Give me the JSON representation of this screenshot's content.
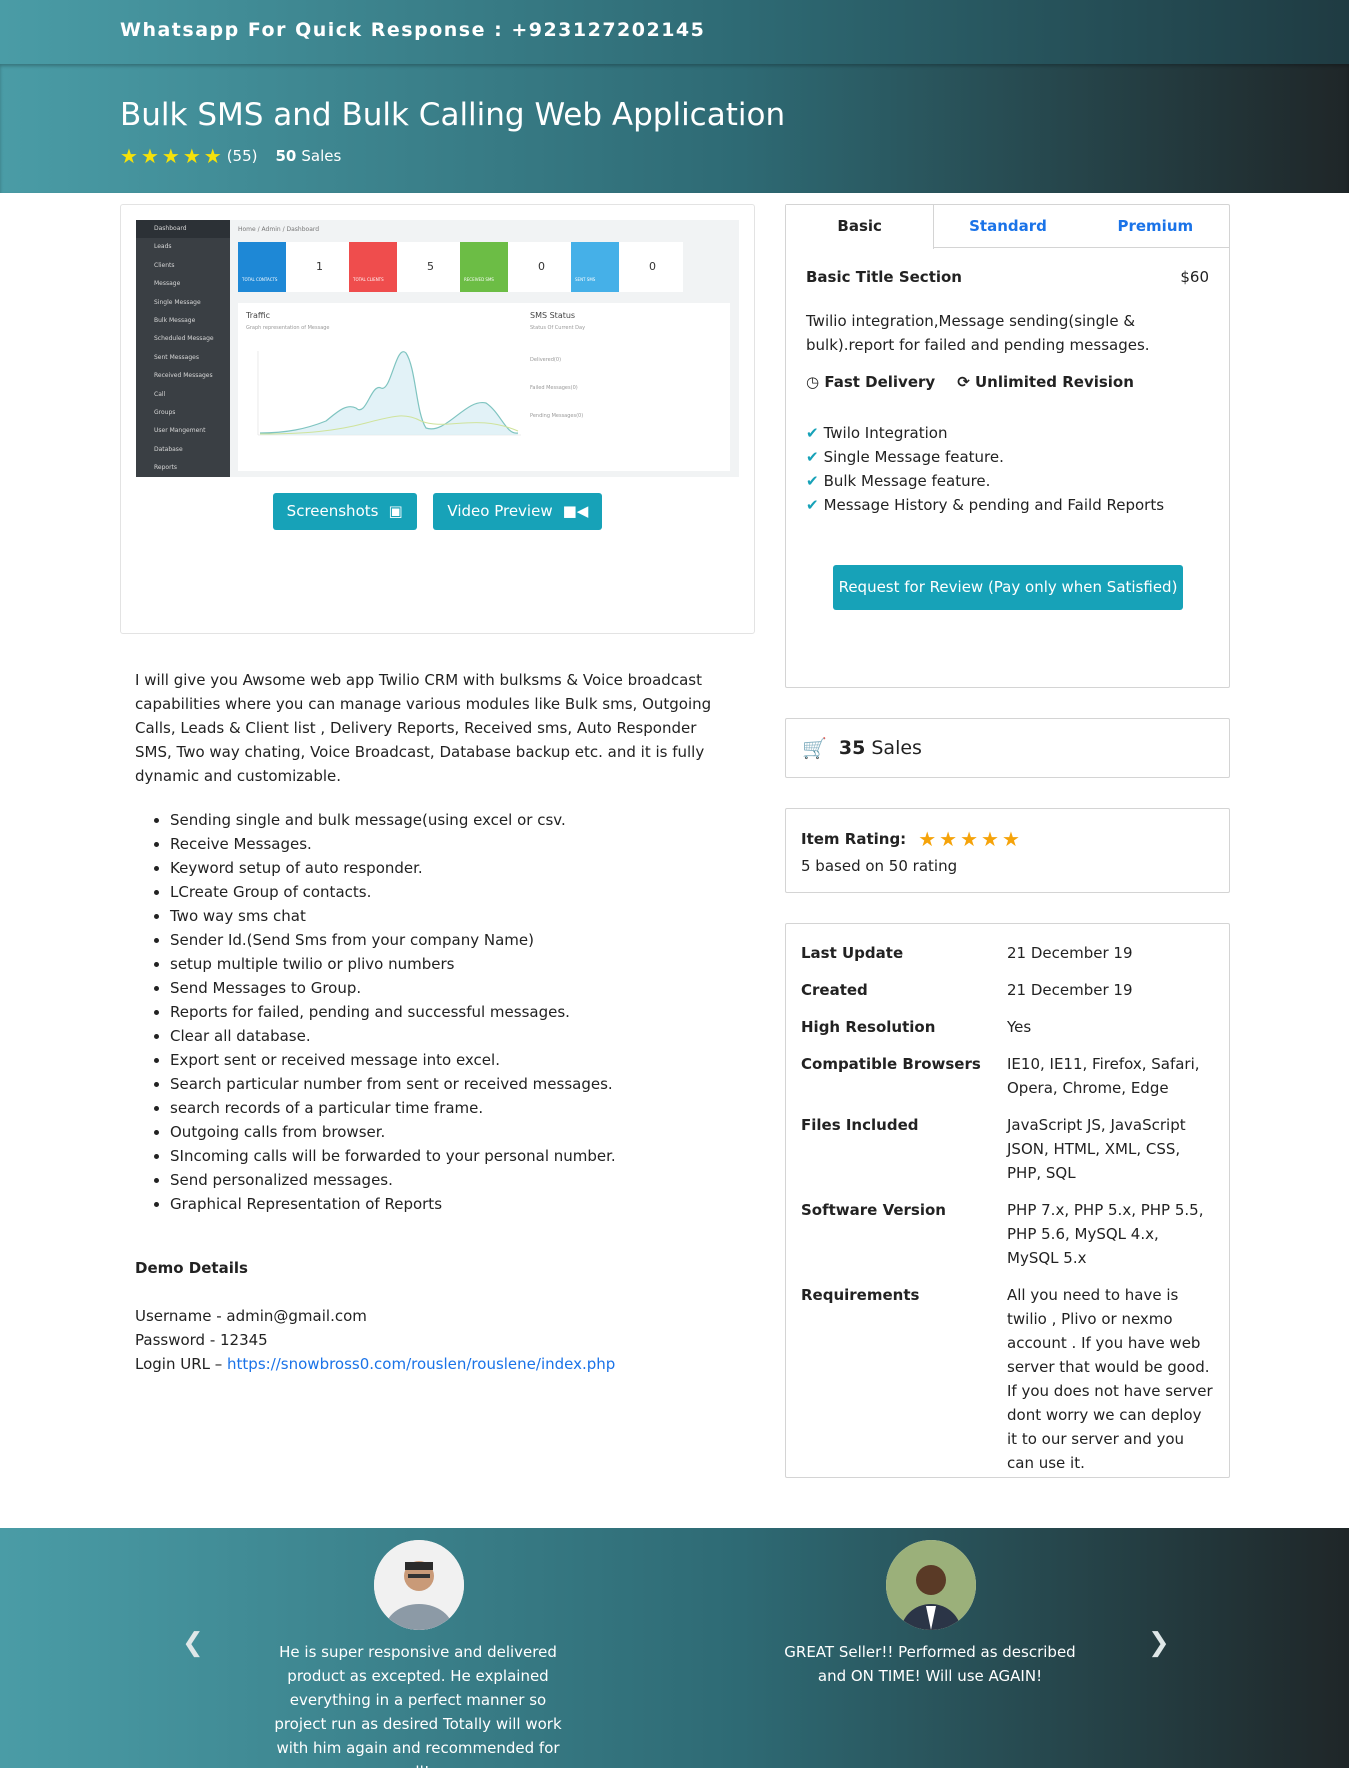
{
  "topbar": {
    "whatsapp": "Whatsapp For Quick Response : +923127202145"
  },
  "hero": {
    "title": "Bulk SMS and Bulk Calling Web Application",
    "rating_count": "(55)",
    "sales_num": "50",
    "sales_label": "Sales"
  },
  "screenshot": {
    "sidebar": [
      "Dashboard",
      "Leads",
      "Clients",
      "Message",
      "Single Message",
      "Bulk Message",
      "Scheduled Message",
      "Sent Messages",
      "Received Messages",
      "Call",
      "Groups",
      "User Mangement",
      "Database",
      "Reports"
    ],
    "crumb": "Home / Admin / Dashboard",
    "kpis": [
      {
        "label": "TOTAL CONTACTS",
        "value": "1",
        "color": "#1e88d6"
      },
      {
        "label": "TOTAL CLIENTS",
        "value": "5",
        "color": "#ef4d4d"
      },
      {
        "label": "RECEIVED SMS",
        "value": "0",
        "color": "#6cbd45"
      },
      {
        "label": "SENT SMS",
        "value": "0",
        "color": "#45b0e8"
      }
    ],
    "panel_title": "Traffic",
    "panel_sub": "Graph representation of Message",
    "status_title": "SMS Status",
    "status_sub": "Status Of Current Day",
    "status_items": [
      "Delivered(0)",
      "Failed Messages(0)",
      "Pending Messages(0)"
    ]
  },
  "buttons": {
    "screenshots": "Screenshots",
    "video": "Video Preview"
  },
  "description": {
    "intro": "I will give you Awsome web app Twilio CRM with bulksms & Voice broadcast capabilities where you can manage various modules like Bulk sms, Outgoing Calls, Leads & Client list , Delivery Reports, Received sms, Auto Responder SMS, Two way chating, Voice Broadcast, Database backup etc. and it is fully dynamic and customizable.",
    "features": [
      "Sending single and bulk message(using excel or csv.",
      "Receive Messages.",
      "Keyword setup of auto responder.",
      "LCreate Group of contacts.",
      "Two way sms chat",
      "Sender Id.(Send Sms from your company Name)",
      "setup multiple twilio or plivo numbers",
      "Send Messages to Group.",
      "Reports for failed, pending and successful messages.",
      "Clear all database.",
      "Export sent or received message into excel.",
      "Search particular number from sent or received messages.",
      "search records of a particular time frame.",
      "Outgoing calls from browser.",
      "SIncoming calls will be forwarded to your personal number.",
      "Send personalized messages.",
      "Graphical Representation of Reports"
    ],
    "demo_title": "Demo Details",
    "username": "Username - admin@gmail.com",
    "password": "Password - 12345",
    "login_label": "Login URL – ",
    "login_url": "https://snowbross0.com/rouslen/rouslene/index.php"
  },
  "pricing": {
    "tabs": [
      "Basic",
      "Standard",
      "Premium"
    ],
    "title": "Basic Title Section",
    "price": "$60",
    "desc": "Twilio integration,Message sending(single & bulk).report for failed and pending messages.",
    "delivery": "Fast Delivery",
    "revision": "Unlimited Revision",
    "items": [
      "Twilo Integration",
      "Single Message feature.",
      "Bulk Message feature.",
      "Message History & pending and Faild Reports"
    ],
    "cta": "Request for Review (Pay only when Satisfied)"
  },
  "sales": {
    "num": "35",
    "label": "Sales"
  },
  "rating": {
    "label": "Item Rating:",
    "text": "5 based on 50 rating"
  },
  "info": [
    {
      "k": "Last Update",
      "v": "21 December 19"
    },
    {
      "k": "Created",
      "v": "21 December 19"
    },
    {
      "k": "High Resolution",
      "v": "Yes"
    },
    {
      "k": "Compatible Browsers",
      "v": "IE10, IE11, Firefox, Safari, Opera, Chrome, Edge"
    },
    {
      "k": "Files Included",
      "v": "JavaScript JS, JavaScript JSON, HTML, XML, CSS, PHP, SQL"
    },
    {
      "k": "Software Version",
      "v": "PHP 7.x, PHP 5.x, PHP 5.5, PHP 5.6, MySQL 4.x, MySQL 5.x"
    },
    {
      "k": "Requirements",
      "v": "All you need to have is twilio , Plivo or nexmo account . If you have web server that would be good. If you does not have server dont worry we can deploy it to our server and you can use it."
    }
  ],
  "testimonials": [
    {
      "text": "He is super responsive and delivered product as excepted. He explained everything in a perfect manner so project run as desired Totally will work with him again and recommended for all!"
    },
    {
      "text": "GREAT Seller!! Performed as described and ON TIME! Will use AGAIN!"
    }
  ]
}
